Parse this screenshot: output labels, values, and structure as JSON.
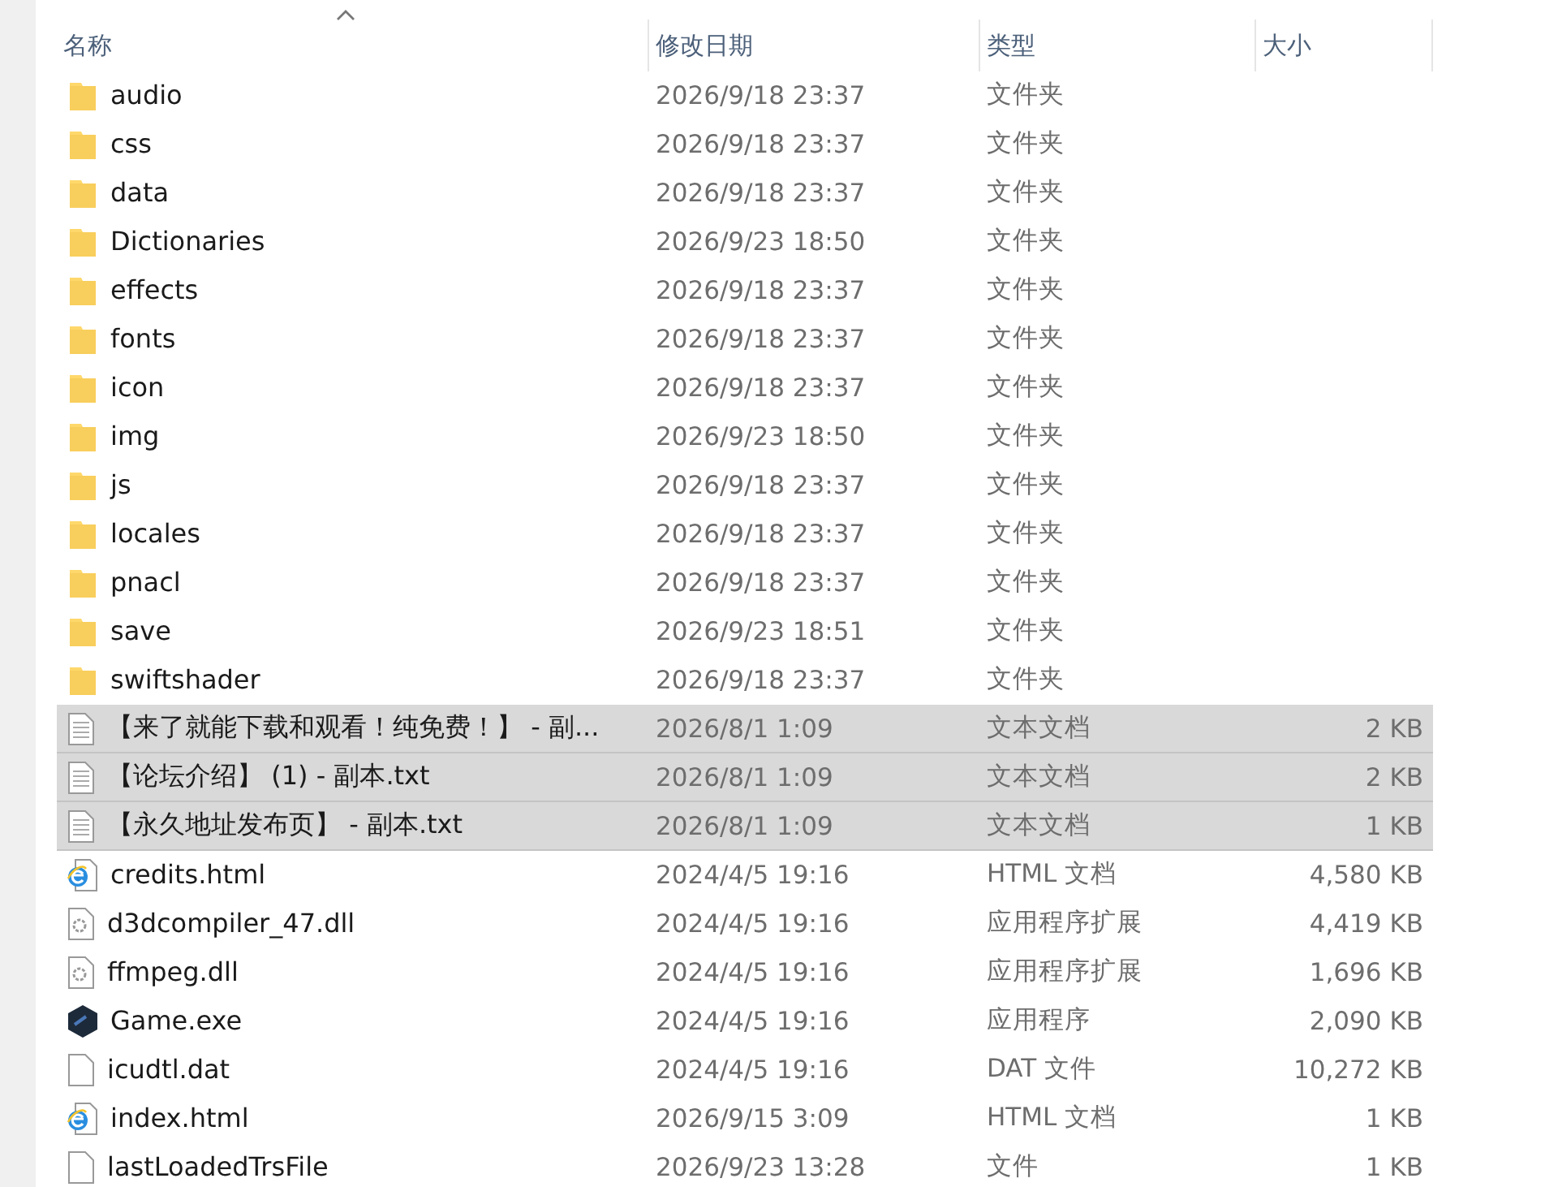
{
  "columns": [
    {
      "label": "名称",
      "sorted": true
    },
    {
      "label": "修改日期",
      "sorted": false
    },
    {
      "label": "类型",
      "sorted": false
    },
    {
      "label": "大小",
      "sorted": false
    }
  ],
  "rows": [
    {
      "kind": "folder",
      "name": "audio",
      "date": "2026/9/18 23:37",
      "type": "文件夹",
      "selected": false
    },
    {
      "kind": "folder",
      "name": "css",
      "date": "2026/9/18 23:37",
      "type": "文件夹",
      "selected": false
    },
    {
      "kind": "folder",
      "name": "data",
      "date": "2026/9/18 23:37",
      "type": "文件夹",
      "selected": false
    },
    {
      "kind": "folder",
      "name": "Dictionaries",
      "date": "2026/9/23 18:50",
      "type": "文件夹",
      "selected": false
    },
    {
      "kind": "folder",
      "name": "effects",
      "date": "2026/9/18 23:37",
      "type": "文件夹",
      "selected": false
    },
    {
      "kind": "folder",
      "name": "fonts",
      "date": "2026/9/18 23:37",
      "type": "文件夹",
      "selected": false
    },
    {
      "kind": "folder",
      "name": "icon",
      "date": "2026/9/18 23:37",
      "type": "文件夹",
      "selected": false
    },
    {
      "kind": "folder",
      "name": "img",
      "date": "2026/9/23 18:50",
      "type": "文件夹",
      "selected": false
    },
    {
      "kind": "folder",
      "name": "js",
      "date": "2026/9/18 23:37",
      "type": "文件夹",
      "selected": false
    },
    {
      "kind": "folder",
      "name": "locales",
      "date": "2026/9/18 23:37",
      "type": "文件夹",
      "selected": false
    },
    {
      "kind": "folder",
      "name": "pnacl",
      "date": "2026/9/18 23:37",
      "type": "文件夹",
      "selected": false
    },
    {
      "kind": "folder",
      "name": "save",
      "date": "2026/9/23 18:51",
      "type": "文件夹",
      "selected": false
    },
    {
      "kind": "folder",
      "name": "swiftshader",
      "date": "2026/9/18 23:37",
      "type": "文件夹",
      "selected": false
    },
    {
      "kind": "text",
      "name": "【来了就能下载和观看！纯免费！】 - 副...",
      "date": "2026/8/1 1:09",
      "type": "文本文档",
      "size": "2 KB",
      "selected": true
    },
    {
      "kind": "text",
      "name": "【论坛介绍】 (1) - 副本.txt",
      "date": "2026/8/1 1:09",
      "type": "文本文档",
      "size": "2 KB",
      "selected": true
    },
    {
      "kind": "text",
      "name": "【永久地址发布页】  - 副本.txt",
      "date": "2026/8/1 1:09",
      "type": "文本文档",
      "size": "1 KB",
      "selected": true
    },
    {
      "kind": "html",
      "name": "credits.html",
      "date": "2024/4/5 19:16",
      "type": "HTML 文档",
      "size": "4,580 KB",
      "selected": false
    },
    {
      "kind": "dll",
      "name": "d3dcompiler_47.dll",
      "date": "2024/4/5 19:16",
      "type": "应用程序扩展",
      "size": "4,419 KB",
      "selected": false
    },
    {
      "kind": "dll",
      "name": "ffmpeg.dll",
      "date": "2024/4/5 19:16",
      "type": "应用程序扩展",
      "size": "1,696 KB",
      "selected": false
    },
    {
      "kind": "exe",
      "name": "Game.exe",
      "date": "2024/4/5 19:16",
      "type": "应用程序",
      "size": "2,090 KB",
      "selected": false
    },
    {
      "kind": "file",
      "name": "icudtl.dat",
      "date": "2024/4/5 19:16",
      "type": "DAT 文件",
      "size": "10,272 KB",
      "selected": false
    },
    {
      "kind": "html",
      "name": "index.html",
      "date": "2026/9/15 3:09",
      "type": "HTML 文档",
      "size": "1 KB",
      "selected": false
    },
    {
      "kind": "file",
      "name": "lastLoadedTrsFile",
      "date": "2026/9/23 13:28",
      "type": "文件",
      "size": "1 KB",
      "selected": false
    }
  ]
}
